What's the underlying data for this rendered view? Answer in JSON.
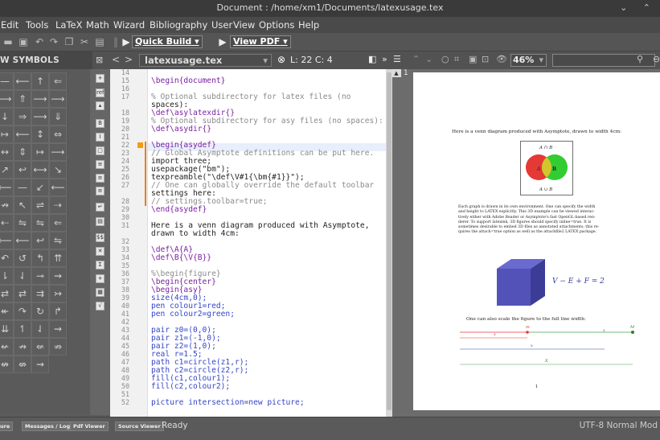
{
  "window": {
    "title": "Document : /home/xm1/Documents/latexusage.tex",
    "controls": "⌄ ⌃"
  },
  "menu": [
    "Edit",
    "Tools",
    "LaTeX",
    "Math",
    "Wizard",
    "Bibliography",
    "User",
    "View",
    "Options",
    "Help"
  ],
  "toolbar": {
    "quick_build": "Quick Build",
    "view_pdf": "View PDF"
  },
  "symbols": {
    "header": "W SYMBOLS",
    "rows": [
      [
        "—",
        "⟵",
        "↑",
        "⇐"
      ],
      [
        "⟶",
        "⇑",
        "⟶",
        "⟶"
      ],
      [
        "↓",
        "⇒",
        "⟶",
        "⇓"
      ],
      [
        "↦",
        "⟵",
        "↕",
        "⇔"
      ],
      [
        "↔",
        "⇕",
        "↦",
        "⟶"
      ],
      [
        "↗",
        "↩",
        "⟷",
        "↘"
      ],
      [
        "⟵",
        "—",
        "↙",
        "⟵"
      ],
      [
        "↛",
        "↖",
        "⇌",
        "⇢"
      ],
      [
        "⇠",
        "⇋",
        "⇋",
        "⇐"
      ],
      [
        "⟵",
        "⟵",
        "↩",
        "⇋"
      ],
      [
        "↶",
        "↺",
        "↰",
        "⇈"
      ],
      [
        "⇂",
        "⇃",
        "⊸",
        "⇝"
      ],
      [
        "⇄",
        "⇄",
        "⇉",
        "↣"
      ],
      [
        "↞",
        "↷",
        "↻",
        "↱"
      ],
      [
        "⇊",
        "↿",
        "⇃",
        "⇝"
      ],
      [
        "↚",
        "↛",
        "⇍",
        "⇏"
      ],
      [
        "↮",
        "⇎",
        "⇝",
        ""
      ]
    ]
  },
  "editor": {
    "file_combo": "latexusage.tex",
    "cursor": "L: 22 C: 4",
    "zoom": "46%",
    "line_numbers": [
      "14",
      "15",
      "16",
      "17",
      "",
      "18",
      "19",
      "20",
      "21",
      "22",
      "23",
      "24",
      "25",
      "26",
      "27",
      "",
      "28",
      "29",
      "30",
      "31",
      "",
      "32",
      "33",
      "34",
      "35",
      "36",
      "37",
      "38",
      "39",
      "40",
      "41",
      "42",
      "43",
      "44",
      "45",
      "46",
      "47",
      "48",
      "49",
      "50",
      "51",
      "52"
    ],
    "lines": [
      "",
      "\\begin{document}",
      "",
      "% Optional subdirectory for latex files (no",
      "spaces):",
      "\\def\\asylatexdir{}",
      "% Optional subdirectory for asy files (no spaces):",
      "\\def\\asydir{}",
      "",
      "\\begin{asydef}",
      "// Global Asymptote definitions can be put here.",
      "import three;",
      "usepackage(\"bm\");",
      "texpreamble(\"\\def\\V#1{\\bm{#1}}\");",
      "// One can globally override the default toolbar",
      "settings here:",
      "// settings.toolbar=true;",
      "\\end{asydef}",
      "",
      "Here is a venn diagram produced with Asymptote,",
      "drawn to width 4cm:",
      "",
      "\\def\\A{A}",
      "\\def\\B{\\V{B}}",
      "",
      "%\\begin{figure}",
      "\\begin{center}",
      "\\begin{asy}",
      "size(4cm,0);",
      "pen colour1=red;",
      "pen colour2=green;",
      "",
      "pair z0=(0,0);",
      "pair z1=(-1,0);",
      "pair z2=(1,0);",
      "real r=1.5;",
      "path c1=circle(z1,r);",
      "path c2=circle(z2,r);",
      "fill(c1,colour1);",
      "fill(c2,colour2);",
      "",
      "picture intersection=new picture;"
    ]
  },
  "pdf": {
    "page_number": "1",
    "caption1": "Here is a venn diagram produced with Asymptote, drawn to width 4cm:",
    "venn_top": "A ∩ B",
    "venn_bottom": "A ∪ B",
    "venn_a": "A",
    "venn_b": "B",
    "para": [
      "Each graph is drawn in its own environment. One can specify the width",
      "and height to LATEX explicitly. This 3D example can be viewed interac-",
      "tively either with Adobe Reader or Asymptote's fast OpenGL-based ren-",
      "derer. To support latexmk, 3D figures should specify inline=true. It is",
      "sometimes desirable to embed 3D files as annotated attachments; this re-",
      "quires the attach=true option as well as the attachfile2 LATEX package."
    ],
    "euler": "V − E + F = 2",
    "caption2": "One can also scale the figure to the full line width:",
    "dim_labels": [
      "m",
      "M",
      "x",
      "x",
      "x",
      "X"
    ],
    "page_footer": "1"
  },
  "status": {
    "tabs": [
      "ure",
      "Messages / Log",
      "Pdf Viewer",
      "Source Viewer"
    ],
    "ready": "Ready",
    "right": "UTF-8   Normal Mod"
  }
}
